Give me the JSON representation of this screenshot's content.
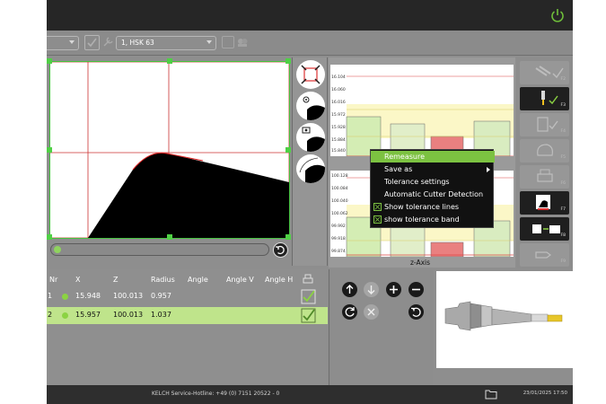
{
  "toolbar": {
    "tool_select": "1, HSK 63"
  },
  "table": {
    "headers": {
      "nr": "Nr",
      "x": "X",
      "z": "Z",
      "radius": "Radius",
      "angle": "Angle",
      "angle_v": "Angle V",
      "angle_h": "Angle H"
    },
    "rows": [
      {
        "nr": "1",
        "x": "15.948",
        "z": "100.013",
        "radius": "0.957"
      },
      {
        "nr": "2",
        "x": "15.957",
        "z": "100.013",
        "radius": "1.037"
      }
    ]
  },
  "charts": {
    "upper_ticks": [
      "16.104",
      "16.060",
      "16.016",
      "15.972",
      "15.928",
      "15.884",
      "15.840"
    ],
    "lower_ticks": [
      "100.128",
      "100.084",
      "100.040",
      "100.062",
      "99.992",
      "99.918",
      "99.874"
    ],
    "lower_axis_label": "z-Axis"
  },
  "context_menu": {
    "remeasure": "Remeasure",
    "save_as": "Save as",
    "tolerance_settings": "Tolerance settings",
    "auto_cutter": "Automatic Cutter Detection",
    "show_tol_lines": "Show tolerance lines",
    "show_tol_band": "show tolerance band"
  },
  "sidebar": {
    "f2": "F2",
    "f3": "F3",
    "f4": "F4",
    "f5": "F5",
    "f6": "F6",
    "f7": "F7",
    "f8": "F8",
    "f9": "F9"
  },
  "statusbar": {
    "hotline": "KELCH Service-Hotline: +49 (0) 7151 20522 - 0",
    "datetime": "23/01/2025 17:50"
  },
  "colors": {
    "accent_green": "#7cc241",
    "selection_green": "#bfe48b",
    "topbar": "#262626"
  }
}
